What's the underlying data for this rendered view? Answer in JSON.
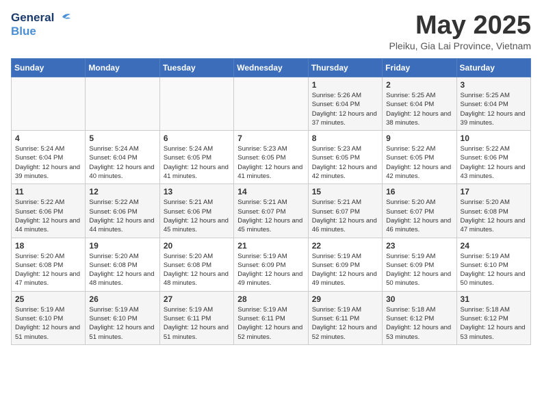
{
  "header": {
    "logo_general": "General",
    "logo_blue": "Blue",
    "month_title": "May 2025",
    "location": "Pleiku, Gia Lai Province, Vietnam"
  },
  "weekdays": [
    "Sunday",
    "Monday",
    "Tuesday",
    "Wednesday",
    "Thursday",
    "Friday",
    "Saturday"
  ],
  "weeks": [
    [
      {
        "day": "",
        "info": ""
      },
      {
        "day": "",
        "info": ""
      },
      {
        "day": "",
        "info": ""
      },
      {
        "day": "",
        "info": ""
      },
      {
        "day": "1",
        "info": "Sunrise: 5:26 AM\nSunset: 6:04 PM\nDaylight: 12 hours\nand 37 minutes."
      },
      {
        "day": "2",
        "info": "Sunrise: 5:25 AM\nSunset: 6:04 PM\nDaylight: 12 hours\nand 38 minutes."
      },
      {
        "day": "3",
        "info": "Sunrise: 5:25 AM\nSunset: 6:04 PM\nDaylight: 12 hours\nand 39 minutes."
      }
    ],
    [
      {
        "day": "4",
        "info": "Sunrise: 5:24 AM\nSunset: 6:04 PM\nDaylight: 12 hours\nand 39 minutes."
      },
      {
        "day": "5",
        "info": "Sunrise: 5:24 AM\nSunset: 6:04 PM\nDaylight: 12 hours\nand 40 minutes."
      },
      {
        "day": "6",
        "info": "Sunrise: 5:24 AM\nSunset: 6:05 PM\nDaylight: 12 hours\nand 41 minutes."
      },
      {
        "day": "7",
        "info": "Sunrise: 5:23 AM\nSunset: 6:05 PM\nDaylight: 12 hours\nand 41 minutes."
      },
      {
        "day": "8",
        "info": "Sunrise: 5:23 AM\nSunset: 6:05 PM\nDaylight: 12 hours\nand 42 minutes."
      },
      {
        "day": "9",
        "info": "Sunrise: 5:22 AM\nSunset: 6:05 PM\nDaylight: 12 hours\nand 42 minutes."
      },
      {
        "day": "10",
        "info": "Sunrise: 5:22 AM\nSunset: 6:06 PM\nDaylight: 12 hours\nand 43 minutes."
      }
    ],
    [
      {
        "day": "11",
        "info": "Sunrise: 5:22 AM\nSunset: 6:06 PM\nDaylight: 12 hours\nand 44 minutes."
      },
      {
        "day": "12",
        "info": "Sunrise: 5:22 AM\nSunset: 6:06 PM\nDaylight: 12 hours\nand 44 minutes."
      },
      {
        "day": "13",
        "info": "Sunrise: 5:21 AM\nSunset: 6:06 PM\nDaylight: 12 hours\nand 45 minutes."
      },
      {
        "day": "14",
        "info": "Sunrise: 5:21 AM\nSunset: 6:07 PM\nDaylight: 12 hours\nand 45 minutes."
      },
      {
        "day": "15",
        "info": "Sunrise: 5:21 AM\nSunset: 6:07 PM\nDaylight: 12 hours\nand 46 minutes."
      },
      {
        "day": "16",
        "info": "Sunrise: 5:20 AM\nSunset: 6:07 PM\nDaylight: 12 hours\nand 46 minutes."
      },
      {
        "day": "17",
        "info": "Sunrise: 5:20 AM\nSunset: 6:08 PM\nDaylight: 12 hours\nand 47 minutes."
      }
    ],
    [
      {
        "day": "18",
        "info": "Sunrise: 5:20 AM\nSunset: 6:08 PM\nDaylight: 12 hours\nand 47 minutes."
      },
      {
        "day": "19",
        "info": "Sunrise: 5:20 AM\nSunset: 6:08 PM\nDaylight: 12 hours\nand 48 minutes."
      },
      {
        "day": "20",
        "info": "Sunrise: 5:20 AM\nSunset: 6:08 PM\nDaylight: 12 hours\nand 48 minutes."
      },
      {
        "day": "21",
        "info": "Sunrise: 5:19 AM\nSunset: 6:09 PM\nDaylight: 12 hours\nand 49 minutes."
      },
      {
        "day": "22",
        "info": "Sunrise: 5:19 AM\nSunset: 6:09 PM\nDaylight: 12 hours\nand 49 minutes."
      },
      {
        "day": "23",
        "info": "Sunrise: 5:19 AM\nSunset: 6:09 PM\nDaylight: 12 hours\nand 50 minutes."
      },
      {
        "day": "24",
        "info": "Sunrise: 5:19 AM\nSunset: 6:10 PM\nDaylight: 12 hours\nand 50 minutes."
      }
    ],
    [
      {
        "day": "25",
        "info": "Sunrise: 5:19 AM\nSunset: 6:10 PM\nDaylight: 12 hours\nand 51 minutes."
      },
      {
        "day": "26",
        "info": "Sunrise: 5:19 AM\nSunset: 6:10 PM\nDaylight: 12 hours\nand 51 minutes."
      },
      {
        "day": "27",
        "info": "Sunrise: 5:19 AM\nSunset: 6:11 PM\nDaylight: 12 hours\nand 51 minutes."
      },
      {
        "day": "28",
        "info": "Sunrise: 5:19 AM\nSunset: 6:11 PM\nDaylight: 12 hours\nand 52 minutes."
      },
      {
        "day": "29",
        "info": "Sunrise: 5:19 AM\nSunset: 6:11 PM\nDaylight: 12 hours\nand 52 minutes."
      },
      {
        "day": "30",
        "info": "Sunrise: 5:18 AM\nSunset: 6:12 PM\nDaylight: 12 hours\nand 53 minutes."
      },
      {
        "day": "31",
        "info": "Sunrise: 5:18 AM\nSunset: 6:12 PM\nDaylight: 12 hours\nand 53 minutes."
      }
    ]
  ]
}
